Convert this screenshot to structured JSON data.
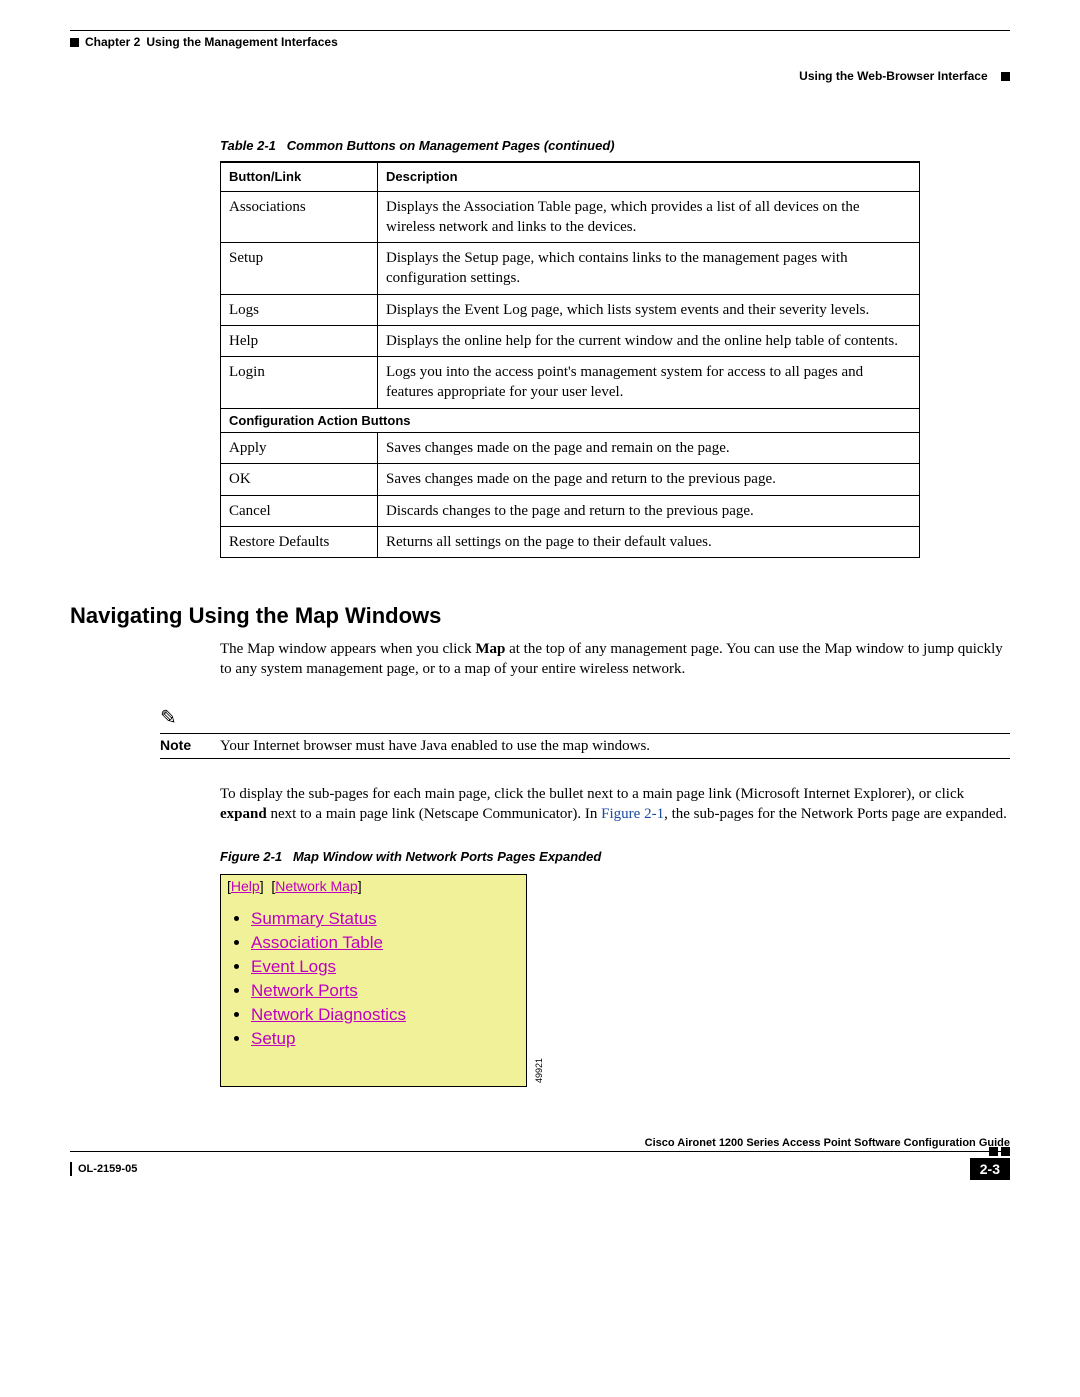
{
  "header": {
    "chapter_label": "Chapter 2",
    "chapter_title": "Using the Management Interfaces",
    "section_title": "Using the Web-Browser Interface"
  },
  "table": {
    "caption_label": "Table 2-1",
    "caption_text": "Common Buttons on Management Pages  (continued)",
    "col1": "Button/Link",
    "col2": "Description",
    "rows": [
      {
        "name": "Associations",
        "desc": "Displays the Association Table page, which provides a list of all devices on the wireless network and links to the devices."
      },
      {
        "name": "Setup",
        "desc": "Displays the Setup page, which contains links to the management pages with configuration settings."
      },
      {
        "name": "Logs",
        "desc": "Displays the Event Log page, which lists system events and their severity levels."
      },
      {
        "name": "Help",
        "desc": "Displays the online help for the current window and the online help table of contents."
      },
      {
        "name": "Login",
        "desc": "Logs you into the access point's management system for access to all pages and features appropriate for your user level."
      }
    ],
    "section_header": "Configuration Action Buttons",
    "action_rows": [
      {
        "name": "Apply",
        "desc": "Saves changes made on the page and remain on the page."
      },
      {
        "name": "OK",
        "desc": "Saves changes made on the page and return to the previous page."
      },
      {
        "name": "Cancel",
        "desc": "Discards changes to the page and return to the previous page."
      },
      {
        "name": "Restore Defaults",
        "desc": "Returns all settings on the page to their default values."
      }
    ]
  },
  "nav_section": {
    "heading": "Navigating Using the Map Windows",
    "para1_pre": "The Map window appears when you click ",
    "para1_bold": "Map",
    "para1_post": " at the top of any management page. You can use the Map window to jump quickly to any system management page, or to a map of your entire wireless network.",
    "note_label": "Note",
    "note_text": "Your Internet browser must have Java enabled to use the map windows.",
    "para2_pre": "To display the sub-pages for each main page, click the bullet next to a main page link (Microsoft Internet Explorer), or click ",
    "para2_bold": "expand",
    "para2_mid": " next to a main page link (Netscape Communicator). In ",
    "para2_xref": "Figure 2-1",
    "para2_post": ", the sub-pages for the Network Ports page are expanded."
  },
  "figure": {
    "caption_label": "Figure 2-1",
    "caption_text": "Map Window with Network Ports Pages Expanded",
    "top_links": {
      "help": "Help",
      "netmap": "Network Map"
    },
    "items": [
      "Summary Status",
      "Association Table",
      "Event Logs",
      "Network Ports",
      "Network Diagnostics",
      "Setup"
    ],
    "fig_id": "49921"
  },
  "footer": {
    "guide_title": "Cisco Aironet 1200 Series Access Point Software Configuration Guide",
    "doc_id": "OL-2159-05",
    "page_num": "2-3"
  }
}
